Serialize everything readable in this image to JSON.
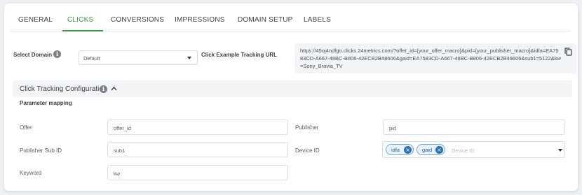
{
  "tabs": [
    {
      "label": "GENERAL",
      "active": false
    },
    {
      "label": "CLICKS",
      "active": true
    },
    {
      "label": "CONVERSIONS",
      "active": false
    },
    {
      "label": "IMPRESSIONS",
      "active": false
    },
    {
      "label": "DOMAIN SETUP",
      "active": false
    },
    {
      "label": "LABELS",
      "active": false
    }
  ],
  "domain": {
    "label": "Select Domain",
    "info_icon": "i",
    "selected": "Default"
  },
  "tracking_url": {
    "label": "Click Example Tracking URL",
    "value": "https://45oj4ndfgo.clicks.24metrics.com/?offer_id={your_offer_macro}&pid={your_publisher_macro}&idfa=EA7583CD-A667-48BC-B806-42ECB2B48606&gaid=EA7583CD-A667-48BC-B806-42ECB2B48606&sub1=5122&kw=Sony_Bravia_TV"
  },
  "config": {
    "title": "Click Tracking Configuration",
    "info_icon": "i",
    "param_title": "Parameter mapping"
  },
  "params": {
    "offer": {
      "label": "Offer",
      "value": "offer_id"
    },
    "publisher": {
      "label": "Publisher",
      "value": "pid"
    },
    "publisher_sub_id": {
      "label": "Publisher Sub ID",
      "value": "sub1"
    },
    "device_id": {
      "label": "Device ID",
      "tags": [
        "idfa",
        "gaid"
      ],
      "placeholder": "Device ID"
    },
    "keyword": {
      "label": "Keyword",
      "value": "kw"
    }
  },
  "colors": {
    "accent": "#2e9e42",
    "chip": "#2a6fba"
  }
}
